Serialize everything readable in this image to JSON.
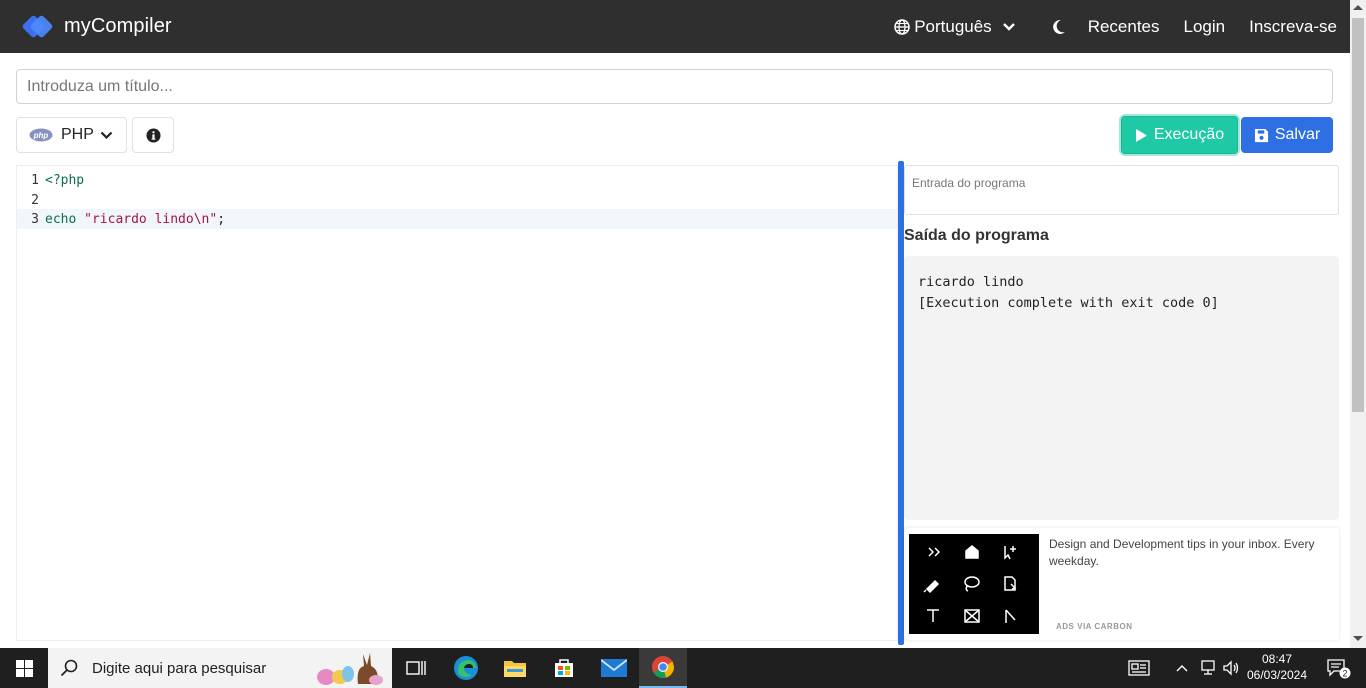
{
  "navbar": {
    "brand": "myCompiler",
    "language": "Português",
    "recent": "Recentes",
    "login": "Login",
    "signup": "Inscreva-se"
  },
  "editor_header": {
    "title_placeholder": "Introduza um título...",
    "language_badge": "php",
    "language": "PHP",
    "run_label": "Execução",
    "save_label": "Salvar"
  },
  "code": {
    "line_numbers": [
      "1",
      "2",
      "3"
    ],
    "line1": "<?php",
    "line3_keyword": "echo",
    "line3_space": " ",
    "line3_string": "\"ricardo lindo\\n\"",
    "line3_end": ";"
  },
  "output_panel": {
    "stdin_placeholder": "Entrada do programa",
    "heading": "Saída do programa",
    "lines": [
      "ricardo lindo",
      "",
      "[Execution complete with exit code 0]"
    ]
  },
  "ad": {
    "text": "Design and Development tips in your inbox. Every weekday.",
    "via": "ADS VIA CARBON"
  },
  "taskbar": {
    "search_placeholder": "Digite aqui para pesquisar",
    "time": "08:47",
    "date": "06/03/2024",
    "notifications": "2"
  },
  "colors": {
    "navbar": "#2f2f2f",
    "run_button": "#20c9a6",
    "save_button": "#2f6fe4",
    "divider": "#2f6fe4"
  }
}
